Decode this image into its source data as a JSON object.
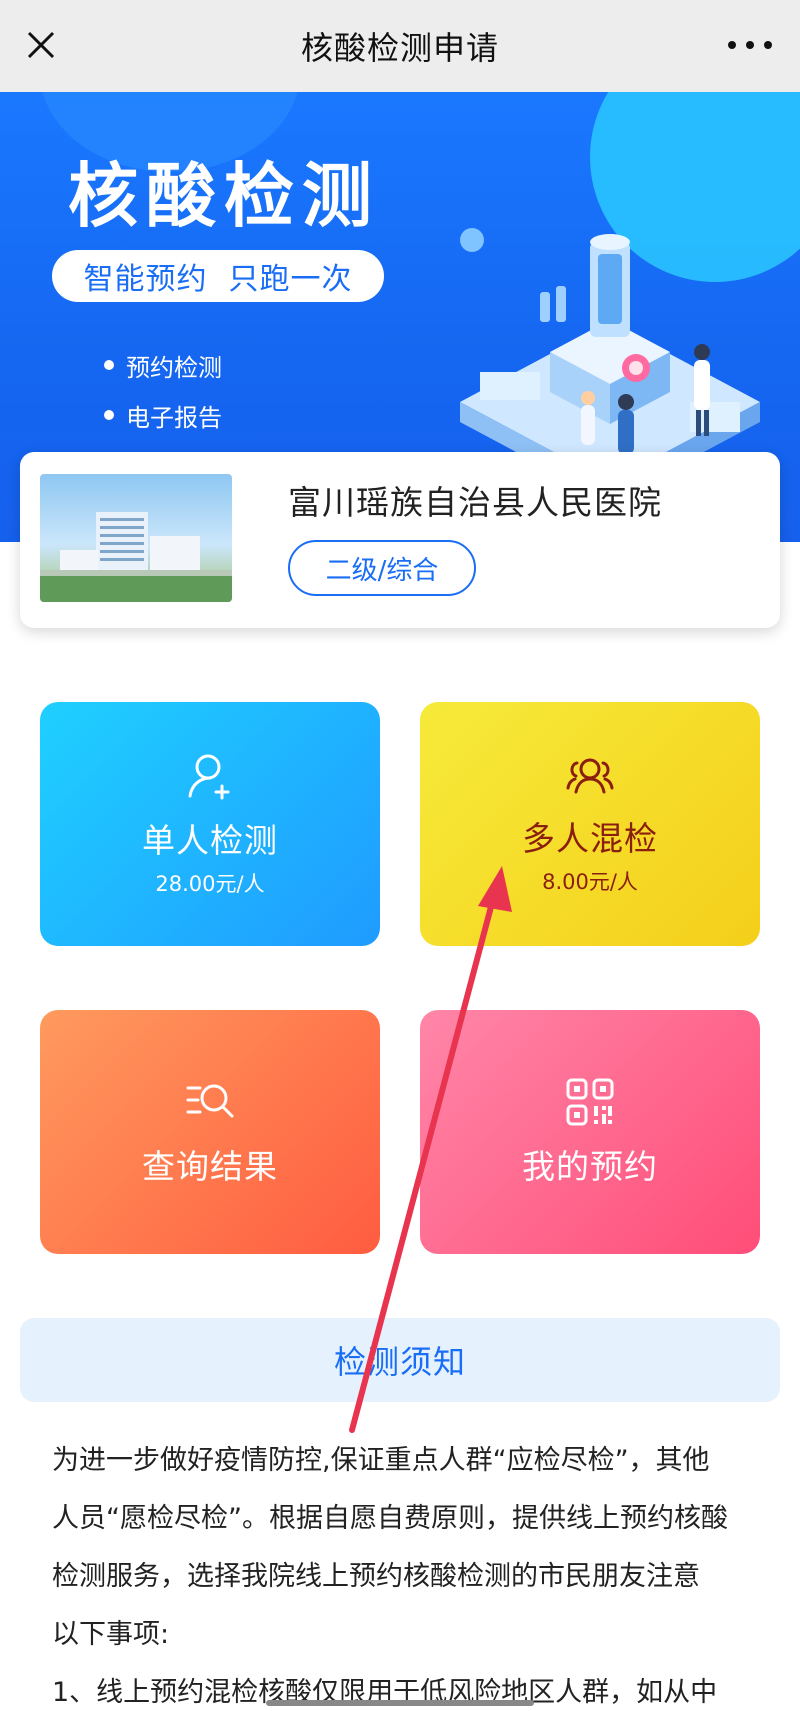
{
  "navbar": {
    "title": "核酸检测申请",
    "close_icon": "close-icon",
    "more_icon": "more-dots-icon"
  },
  "banner": {
    "title": "核酸检测",
    "pill": "智能预约  只跑一次",
    "bullets": [
      "预约检测",
      "电子报告"
    ],
    "bg_color": "#1a78ff"
  },
  "hospital": {
    "name": "富川瑶族自治县人民医院",
    "level": "二级/综合"
  },
  "tiles": {
    "single": {
      "label": "单人检测",
      "price": "28.00元/人",
      "icon": "user-add-icon"
    },
    "multi": {
      "label": "多人混检",
      "price": "8.00元/人",
      "icon": "group-icon"
    },
    "query": {
      "label": "查询结果",
      "icon": "list-search-icon"
    },
    "mine": {
      "label": "我的预约",
      "icon": "qrcode-icon"
    }
  },
  "notice": {
    "title": "检测须知",
    "lines": [
      "为进一步做好疫情防控,保证重点人群“应检尽检”，其他",
      "人员“愿检尽检”。根据自愿自费原则，提供线上预约核酸",
      "检测服务，选择我院线上预约核酸检测的市民朋友注意",
      "以下事项:",
      "1、线上预约混检核酸仅限用于低风险地区人群，如从中"
    ]
  },
  "colors": {
    "accent": "#1a6ef5",
    "annotation_arrow": "#e8344e"
  }
}
